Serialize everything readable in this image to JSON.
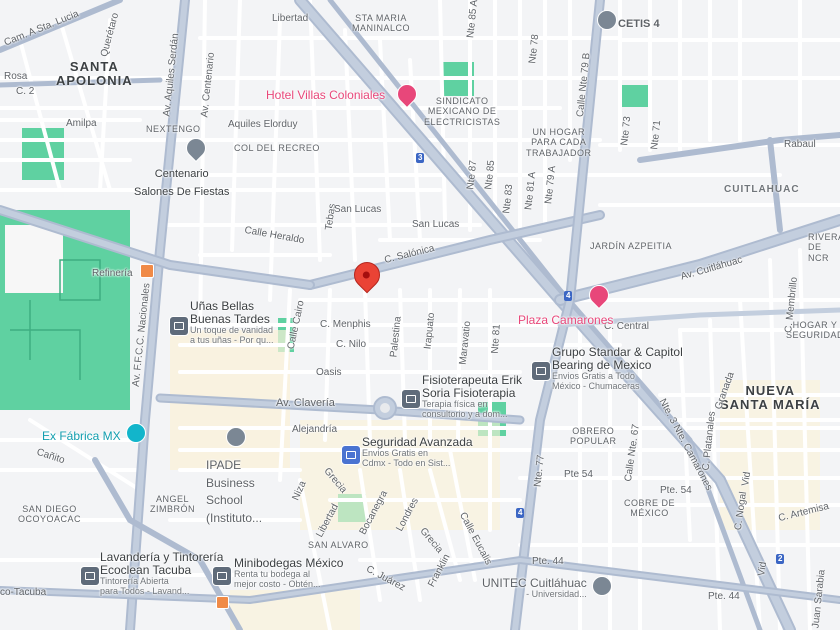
{
  "colors": {
    "background": "#f3f4f6",
    "park": "#5fd1a1",
    "road": "#ffffff",
    "major_road": "#aebbd0",
    "poi_pink": "#e8477a",
    "pin_red": "#ea4335",
    "shield_blue": "#3b66c4",
    "label": "#5f6368"
  },
  "areas": {
    "santa_apolonia": "SANTA\nAPOLONIA",
    "cuitlahuac": "CUITLAHUAC",
    "nueva_santa_maria": "NUEVA\nSANTA MARÍA"
  },
  "neighborhoods": {
    "sta_maria": "STA MARIA\nMANINALCO",
    "nextengo": "NEXTENGO",
    "col_del_recreo": "COL DEL RECREO",
    "sindicato": "SINDICATO\nMEXICANO DE\nELECTRICISTAS",
    "un_hogar": "UN HOGAR\nPARA CADA\nTRABAJADOR",
    "jardin_azpeitia": "JARDÍN AZPEITIA",
    "hogar_seguridad": "HOGAR Y\nSEGURIDAD",
    "obrero_popular": "OBRERO\nPOPULAR",
    "cobre_de_mexico": "COBRE DE\nMÉXICO",
    "angel_zimbron": "ANGEL\nZIMBRÓN",
    "san_diego": "SAN DIEGO\nOCOYOACAC",
    "san_alvaro": "SAN ALVARO",
    "rivera": "RIVERA\nDE\nNCR"
  },
  "streets": {
    "cam_sta_lucia": "Cam. A Sta. Lucia",
    "queretaro": "Querétaro",
    "aquiles_serdan": "Av. Aquiles Serdán",
    "libertad": "Libertad",
    "rosa": "Rosa",
    "c2": "C. 2",
    "amilpa": "Amilpa",
    "av_centenario": "Av. Centenario",
    "aquiles_elorduy": "Aquiles Elorduy",
    "rabaul": "Rabaul",
    "c_heraldo": "Calle Heraldo",
    "tebas": "Tebas",
    "san_lucas_1": "San Lucas",
    "san_lucas_2": "San Lucas",
    "c_salonica": "C. Salónica",
    "av_cuitlahuac": "Av. Cuitláhuac",
    "c_central": "C. Central",
    "c_menphis": "C. Menphis",
    "c_nilo": "C. Nilo",
    "oasis": "Oasis",
    "palestina": "Palestina",
    "irapuato": "Irapuato",
    "maravatio": "Maravatio",
    "nte81": "Nte 81",
    "av_claveria": "Av. Clavería",
    "alejandria": "Alejandría",
    "av_ffcc": "Av. F.F.C.C. Nacionales",
    "canito": "Cañito",
    "nte3_camarones": "Nte. 3 Nte. Camarones",
    "pte54": "Pte 54",
    "pte54b": "Pte. 54",
    "pte44": "Pte. 44",
    "pte44b": "Pte. 44",
    "nte77": "Nte. 77",
    "nte67": "Calle Nte. 67",
    "c_membrillo": "C. Membrillo",
    "c_platanales": "C. Platanales",
    "c_artemisa": "C. Artemisa",
    "vid": "Vid",
    "vid2": "Vid",
    "niza": "Niza",
    "grecia": "Grecia",
    "grecia2": "Grecia",
    "libertad2": "Libertad",
    "bocanegra": "Bocanegra",
    "londres": "Londres",
    "c_juarez": "C. Juárez",
    "franklin": "Franklin",
    "calle_eucalis": "Calle Eucalis",
    "mexico_tacuba": "co-Tacuba",
    "nte85a": "Nte 85 A",
    "nte87": "Nte 87",
    "nte85": "Nte 85",
    "nte83": "Nte 83",
    "nte81a": "Nte 81 A",
    "nte79a": "Nte 79 A",
    "nte79b": "Calle Nte 79 B",
    "nte73": "Nte 73",
    "nte71": "Nte 71",
    "calle_cairo": "Calle Cairo",
    "nte78": "Nte 78",
    "c_nogal": "C. Nogal",
    "juan_sarabia": "Juan Sarabia",
    "c_granada": "Granada",
    "refineria": "Refinería"
  },
  "pois": {
    "cetis": {
      "title": "CETIS 4"
    },
    "hotel": {
      "title": "Hotel Villas Coloniales"
    },
    "salones": {
      "title": "Centenario\nSalones De Fiestas"
    },
    "refineria": {
      "title": "Refinería"
    },
    "unas": {
      "title": "Uñas Bellas\nBuenas Tardes",
      "desc": "Un toque de vanidad\na tus uñas - Por qu..."
    },
    "plaza": {
      "title": "Plaza Camarones"
    },
    "grupo": {
      "title": "Grupo Standar & Capitol\nBearing de Mexico",
      "desc": "Envios Gratis a Todo\nMéxico - Chumaceras"
    },
    "fisio": {
      "title": "Fisioterapeuta Erik\nSoria Fisioterapia",
      "desc": "Terapia física en\nconsultorio y a dom..."
    },
    "exfabrica": {
      "title": "Ex Fábrica MX"
    },
    "ipade": {
      "title": "IPADE\nBusiness\nSchool\n(Instituto..."
    },
    "seguridad": {
      "title": "Seguridad Avanzada",
      "desc": "Envios Gratis en\nCdmx - Todo en Sist..."
    },
    "lavanderia": {
      "title": "Lavandería y Tintorería\nEcoclean Tacuba",
      "desc": "Tintorería Abierta\npara Todos - Lavand..."
    },
    "minibodegas": {
      "title": "Minibodegas México",
      "desc": "Renta tu bodega al\nmejor costo - Obtén..."
    },
    "unitec": {
      "title": "UNITEC Cuitláhuac",
      "desc": "- Universidad..."
    }
  },
  "shields": {
    "s3": "3",
    "s4a": "4",
    "s4b": "4",
    "s2": "2"
  }
}
